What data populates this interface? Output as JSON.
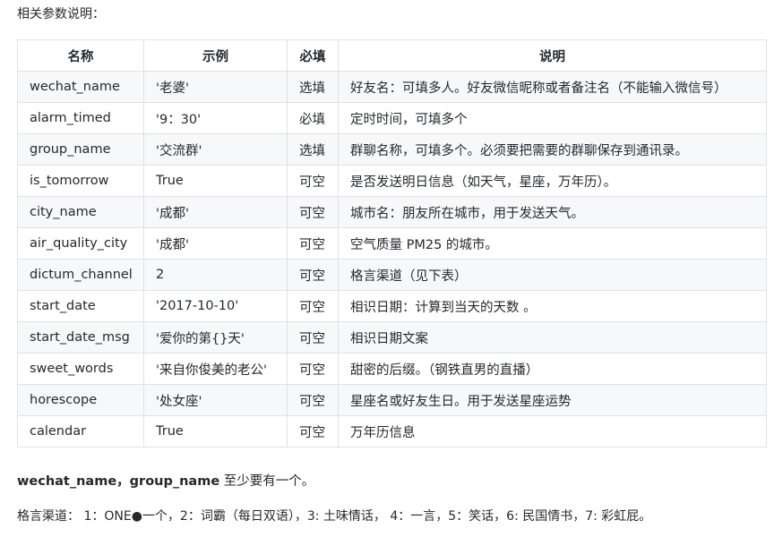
{
  "intro": "相关参数说明：",
  "table": {
    "headers": {
      "name": "名称",
      "example": "示例",
      "required": "必填",
      "description": "说明"
    },
    "rows": [
      {
        "name": "wechat_name",
        "example": "'老婆'",
        "required": "选填",
        "description": "好友名：可填多人。好友微信昵称或者备注名（不能输入微信号）"
      },
      {
        "name": "alarm_timed",
        "example": "'9：30'",
        "required": "必填",
        "description": "定时时间，可填多个"
      },
      {
        "name": "group_name",
        "example": "'交流群'",
        "required": "选填",
        "description": "群聊名称，可填多个。必须要把需要的群聊保存到通讯录。"
      },
      {
        "name": "is_tomorrow",
        "example": "True",
        "required": "可空",
        "description": "是否发送明日信息（如天气，星座，万年历）。"
      },
      {
        "name": "city_name",
        "example": "'成都'",
        "required": "可空",
        "description": "城市名：朋友所在城市，用于发送天气。"
      },
      {
        "name": "air_quality_city",
        "example": "'成都'",
        "required": "可空",
        "description": "空气质量 PM25 的城市。"
      },
      {
        "name": "dictum_channel",
        "example": "2",
        "required": "可空",
        "description": "格言渠道（见下表）"
      },
      {
        "name": "start_date",
        "example": "'2017-10-10'",
        "required": "可空",
        "description": "相识日期：计算到当天的天数 。"
      },
      {
        "name": "start_date_msg",
        "example": "'爱你的第{}天'",
        "required": "可空",
        "description": "相识日期文案"
      },
      {
        "name": "sweet_words",
        "example": "'来自你俊美的老公'",
        "required": "可空",
        "description": "甜密的后缀。（钢铁直男的直播）"
      },
      {
        "name": "horescope",
        "example": "'处女座'",
        "required": "可空",
        "description": "星座名或好友生日。用于发送星座运势"
      },
      {
        "name": "calendar",
        "example": "True",
        "required": "可空",
        "description": "万年历信息"
      }
    ]
  },
  "note": {
    "bold": "wechat_name，group_name",
    "rest": " 至少要有一个。"
  },
  "channels": "格言渠道： 1：ONE●一个，2：词霸（每日双语），3: 土味情话， 4：一言，5：笑话，6: 民国情书，7: 彩虹屁。"
}
